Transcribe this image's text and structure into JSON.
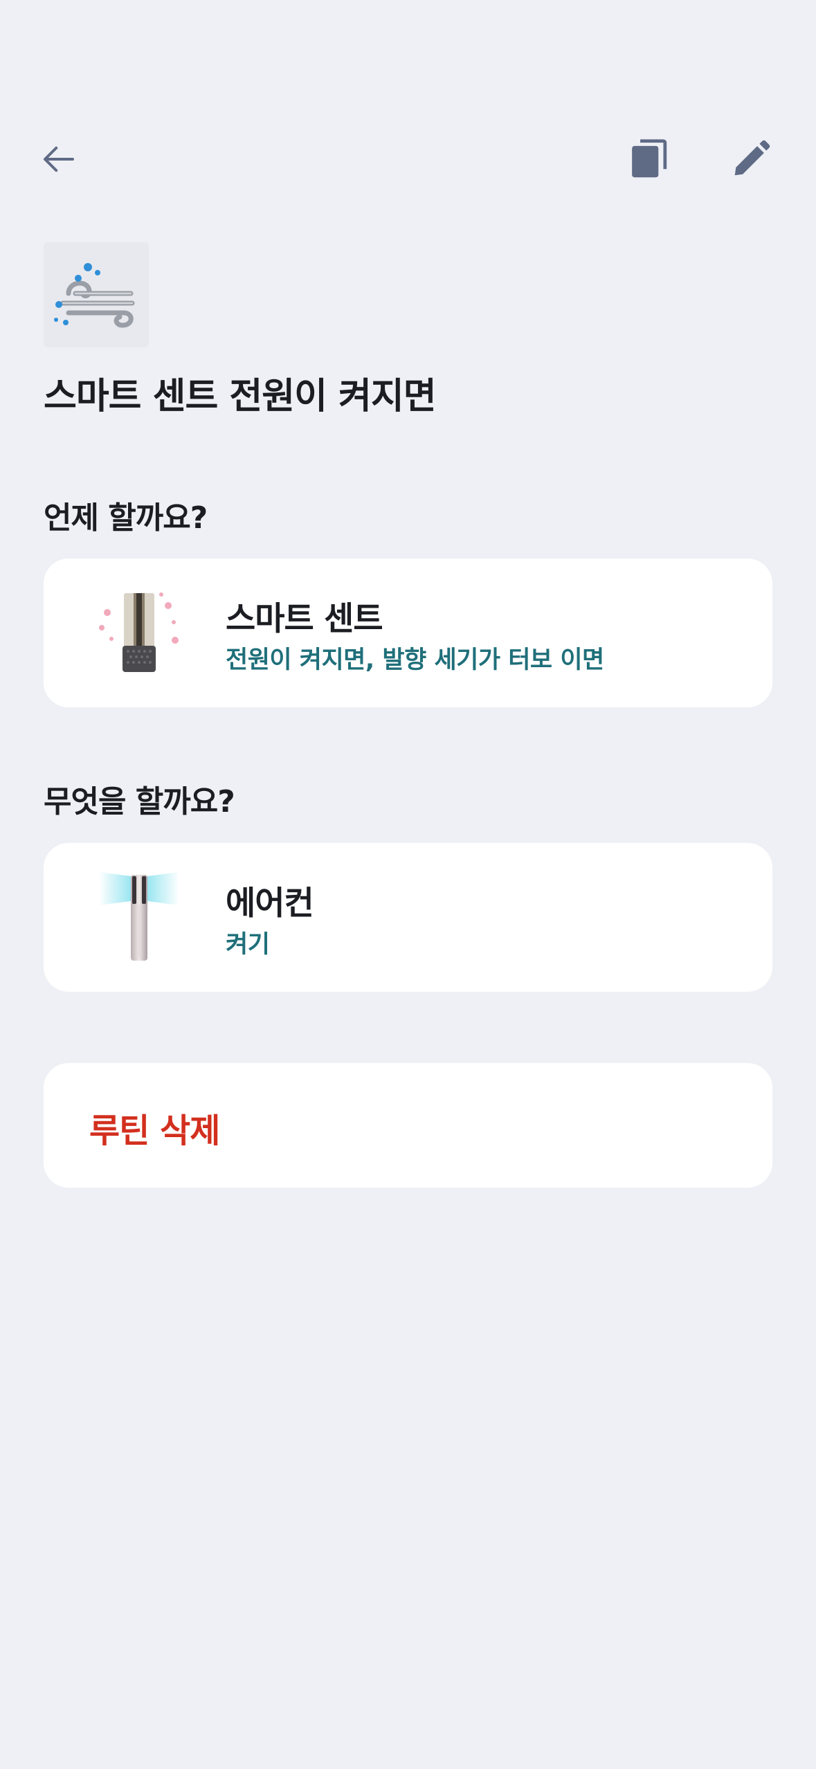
{
  "header": {
    "back_icon": "arrow-left-icon",
    "copy_icon": "copy-icon",
    "edit_icon": "pencil-icon"
  },
  "routine": {
    "icon": "wind-icon",
    "title": "스마트 센트 전원이 켜지면"
  },
  "when": {
    "section_label": "언제 할까요?",
    "device_name": "스마트 센트",
    "condition": "전원이 켜지면, 발향 세기가 터보 이면"
  },
  "what": {
    "section_label": "무엇을 할까요?",
    "device_name": "에어컨",
    "action": "켜기"
  },
  "delete": {
    "label": "루틴 삭제"
  },
  "colors": {
    "background": "#eff0f5",
    "card": "#ffffff",
    "accent_teal": "#1f6f7a",
    "danger": "#d32f1e",
    "icon": "#5f6a85"
  }
}
